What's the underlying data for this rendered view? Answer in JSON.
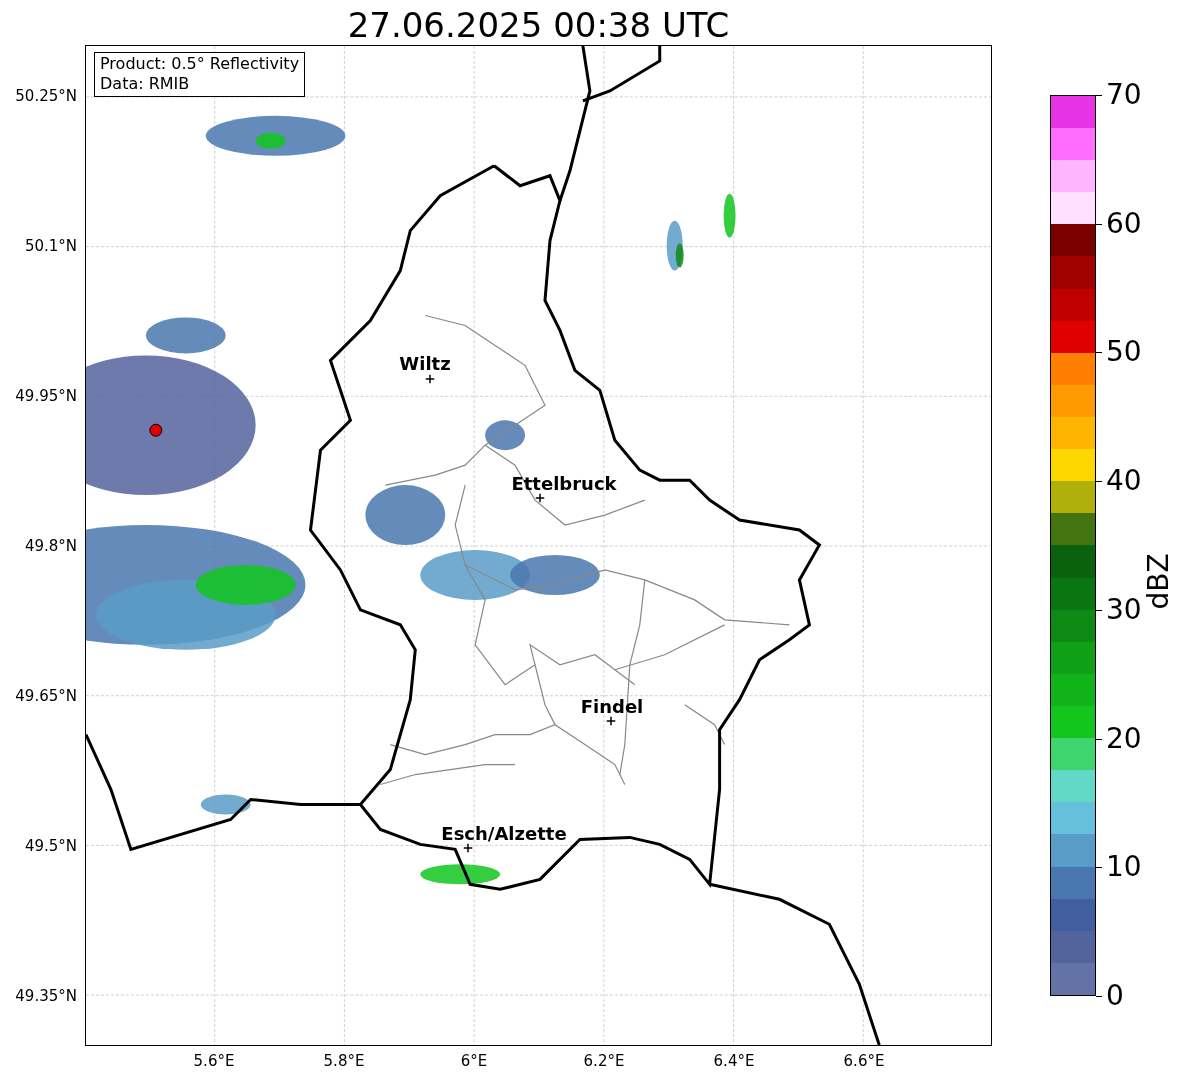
{
  "title": "27.06.2025 00:38 UTC",
  "info_box": [
    "Product: 0.5° Reflectivity",
    "Data: RMIB"
  ],
  "y_ticks": [
    "50.25°N",
    "50.1°N",
    "49.95°N",
    "49.8°N",
    "49.65°N",
    "49.5°N",
    "49.35°N"
  ],
  "x_ticks": [
    "5.6°E",
    "5.8°E",
    "6°E",
    "6.2°E",
    "6.4°E",
    "6.6°E"
  ],
  "cities": [
    {
      "name": "Wiltz"
    },
    {
      "name": "Ettelbruck"
    },
    {
      "name": "Findel"
    },
    {
      "name": "Esch/Alzette"
    }
  ],
  "colorbar": {
    "label": "dBZ",
    "ticks": [
      "70",
      "60",
      "50",
      "40",
      "30",
      "20",
      "10",
      "0"
    ],
    "segments": [
      {
        "color": "#6473a6"
      },
      {
        "color": "#53639c"
      },
      {
        "color": "#415ea0"
      },
      {
        "color": "#4a77af"
      },
      {
        "color": "#5a9cc8"
      },
      {
        "color": "#66c0dc"
      },
      {
        "color": "#62d8c8"
      },
      {
        "color": "#3ed46e"
      },
      {
        "color": "#12c61e"
      },
      {
        "color": "#10b41a"
      },
      {
        "color": "#10a018"
      },
      {
        "color": "#0e8a14"
      },
      {
        "color": "#0a7612"
      },
      {
        "color": "#0a620e"
      },
      {
        "color": "#427410"
      },
      {
        "color": "#b0b00a"
      },
      {
        "color": "#ffd700"
      },
      {
        "color": "#ffb400"
      },
      {
        "color": "#ff9a00"
      },
      {
        "color": "#ff7f00"
      },
      {
        "color": "#e00000"
      },
      {
        "color": "#c00000"
      },
      {
        "color": "#a00000"
      },
      {
        "color": "#7a0000"
      },
      {
        "color": "#ffe0ff"
      },
      {
        "color": "#ffb4ff"
      },
      {
        "color": "#ff6eff"
      },
      {
        "color": "#e633e6"
      }
    ]
  }
}
